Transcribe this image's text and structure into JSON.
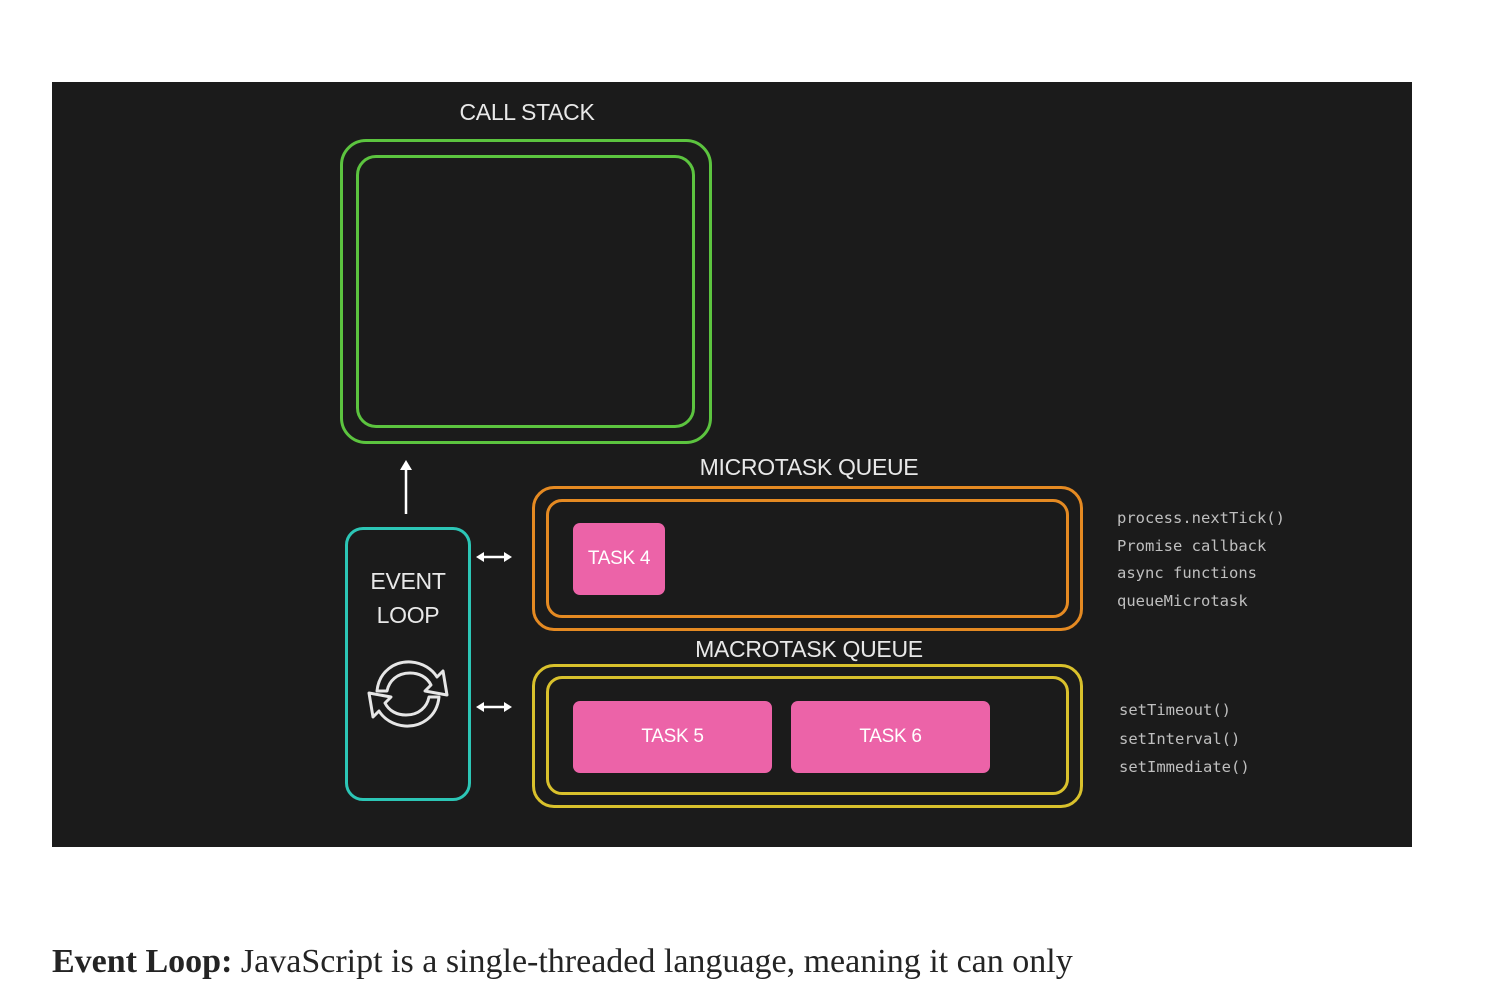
{
  "diagram": {
    "call_stack_title": "CALL STACK",
    "microtask_title": "MICROTASK QUEUE",
    "macrotask_title": "MACROTASK QUEUE",
    "event_loop_line1": "EVENT",
    "event_loop_line2": "LOOP",
    "microtask_tasks": [
      "TASK 4"
    ],
    "macrotask_tasks": [
      "TASK 5",
      "TASK 6"
    ],
    "microtask_apis": [
      "process.nextTick()",
      "Promise callback",
      "async functions",
      "queueMicrotask"
    ],
    "macrotask_apis": [
      "setTimeout()",
      "setInterval()",
      "setImmediate()"
    ],
    "colors": {
      "background": "#1b1b1b",
      "call_stack": "#5cc43f",
      "microtask": "#e58a22",
      "macrotask": "#d9c12c",
      "event_loop": "#2cc6b6",
      "task": "#ec63a8"
    },
    "icons": {
      "event_loop_icon": "refresh-cycle-icon",
      "queue_arrow_icon": "double-arrow-icon",
      "up_arrow_icon": "arrow-up-icon"
    }
  },
  "caption": {
    "term": "Event Loop:",
    "text": " JavaScript is a single-threaded language, meaning it can only"
  }
}
